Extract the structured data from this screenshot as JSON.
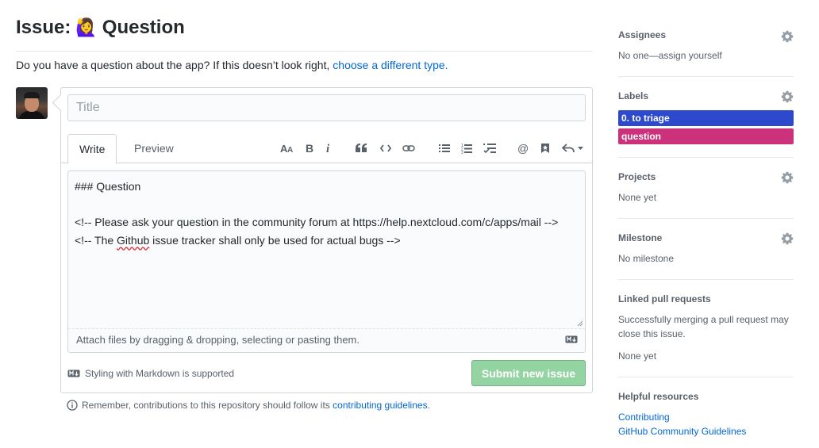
{
  "header": {
    "title_prefix": "Issue:",
    "title_emoji": "🙋‍♀️",
    "title_type": "Question",
    "description": "Do you have a question about the app? If this doesn’t look right,",
    "change_type_link": "choose a different type."
  },
  "form": {
    "title_placeholder": "Title",
    "tabs": [
      {
        "label": "Write",
        "active": true
      },
      {
        "label": "Preview",
        "active": false
      }
    ],
    "toolbar": [
      "text-size-icon",
      "bold-icon",
      "italic-icon",
      "quote-icon",
      "code-icon",
      "link-icon",
      "bulleted-list-icon",
      "numbered-list-icon",
      "task-list-icon",
      "mention-icon",
      "saved-reply-icon",
      "reply-icon"
    ],
    "body": {
      "line1": "### Question",
      "line2": "<!-- Please ask your question in the community forum at https://help.nextcloud.com/c/apps/mail -->",
      "line3_pre": "<!-- The ",
      "line3_squiggle": "Github",
      "line3_post": " issue tracker shall only be used for actual bugs -->"
    },
    "attach_text": "Attach files by dragging & dropping, selecting or pasting them.",
    "markdown_hint": "Styling with Markdown is supported",
    "submit_label": "Submit new issue"
  },
  "footer": {
    "note": "Remember, contributions to this repository should follow its",
    "link": "contributing guidelines",
    "period": "."
  },
  "sidebar": {
    "assignees": {
      "heading": "Assignees",
      "text": "No one—assign yourself"
    },
    "labels": {
      "heading": "Labels",
      "items": [
        {
          "name": "0. to triage",
          "color": "#2d49cc"
        },
        {
          "name": "question",
          "color": "#cc317c"
        }
      ]
    },
    "projects": {
      "heading": "Projects",
      "text": "None yet"
    },
    "milestone": {
      "heading": "Milestone",
      "text": "No milestone"
    },
    "linked_prs": {
      "heading": "Linked pull requests",
      "text": "Successfully merging a pull request may close this issue.",
      "none": "None yet"
    },
    "resources": {
      "heading": "Helpful resources",
      "links": [
        "Contributing",
        "GitHub Community Guidelines"
      ]
    }
  },
  "colors": {
    "link": "#0366d6",
    "submit_disabled": "#94d3a2",
    "border": "#d1d5da"
  }
}
